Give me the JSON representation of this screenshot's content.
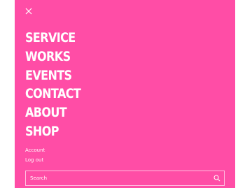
{
  "colors": {
    "panel_bg": "#ff4da6",
    "text": "#ffffff"
  },
  "close": {
    "icon": "close-icon"
  },
  "menu": {
    "items": [
      {
        "label": "SERVICE"
      },
      {
        "label": "WORKS"
      },
      {
        "label": "EVENTS"
      },
      {
        "label": "CONTACT"
      },
      {
        "label": "ABOUT"
      },
      {
        "label": "SHOP"
      }
    ]
  },
  "account_links": {
    "account": "Account",
    "logout": "Log out"
  },
  "search": {
    "placeholder": "Search",
    "value": "",
    "icon": "search-icon"
  }
}
